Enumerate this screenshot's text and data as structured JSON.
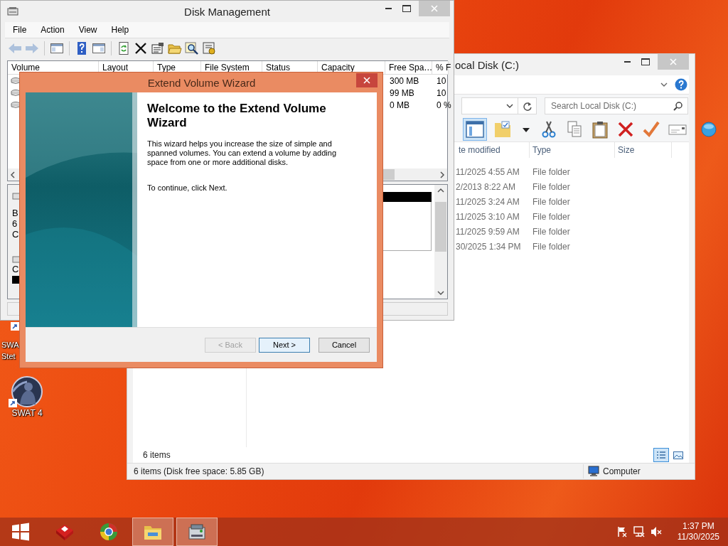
{
  "desktop_icons": [
    {
      "kind": "partial",
      "label_lines": [
        "SWA",
        "Stet"
      ]
    },
    {
      "kind": "game",
      "label_lines": [
        "SWAT 4"
      ]
    }
  ],
  "disk_management": {
    "title": "Disk Management",
    "menu": [
      "File",
      "Action",
      "View",
      "Help"
    ],
    "toolbar": [
      {
        "kind": "back",
        "disabled": true
      },
      {
        "kind": "forward",
        "disabled": true
      },
      {
        "kind": "console",
        "disabled": false
      },
      {
        "kind": "help",
        "disabled": false
      },
      {
        "kind": "action",
        "disabled": false
      },
      {
        "kind": "refresh",
        "disabled": false
      },
      {
        "kind": "delete",
        "disabled": false
      },
      {
        "kind": "properties",
        "disabled": false
      },
      {
        "kind": "open",
        "disabled": false
      },
      {
        "kind": "find",
        "disabled": false
      },
      {
        "kind": "settings",
        "disabled": false
      }
    ],
    "columns": [
      "Volume",
      "Layout",
      "Type",
      "File System",
      "Status",
      "Capacity",
      "Free Spa…",
      "% F"
    ],
    "rows": [
      {
        "free_space": "300 MB",
        "percent_free": "10"
      },
      {
        "free_space": "99 MB",
        "percent_free": "10"
      },
      {
        "free_space": "0 MB",
        "percent_free": "0 %"
      }
    ],
    "disk_info_lines": [
      "B",
      "6",
      "C"
    ],
    "cdrom_label": "C"
  },
  "explorer": {
    "title": "ocal Disk (C:)",
    "search_placeholder": "Search Local Disk (C:)",
    "preview_pane_active": true,
    "toolbar": [
      {
        "kind": "preview-pane"
      },
      {
        "kind": "folder-check"
      },
      {
        "kind": "dropdown"
      },
      {
        "kind": "cut"
      },
      {
        "kind": "copy"
      },
      {
        "kind": "paste"
      },
      {
        "kind": "delete"
      },
      {
        "kind": "check"
      },
      {
        "kind": "rename"
      },
      {
        "kind": "globe"
      }
    ],
    "columns": [
      "te modified",
      "Type",
      "Size"
    ],
    "rows": [
      {
        "date_modified": "11/2025 4:55 AM",
        "type": "File folder"
      },
      {
        "date_modified": "2/2013 8:22 AM",
        "type": "File folder"
      },
      {
        "date_modified": "11/2025 3:24 AM",
        "type": "File folder"
      },
      {
        "date_modified": "11/2025 3:10 AM",
        "type": "File folder"
      },
      {
        "date_modified": "11/2025 9:59 AM",
        "type": "File folder"
      },
      {
        "date_modified": "30/2025 1:34 PM",
        "type": "File folder"
      }
    ],
    "item_count": "6 items",
    "status_text": "6 items (Disk free space: 5.85 GB)",
    "status_location": "Computer",
    "view_buttons": [
      {
        "kind": "details",
        "selected": true
      },
      {
        "kind": "large-icons",
        "selected": false
      }
    ]
  },
  "wizard": {
    "title": "Extend Volume Wizard",
    "heading": "Welcome to the Extend Volume Wizard",
    "body": "This wizard helps you increase the size of simple and spanned volumes. You can extend a volume by adding space from one or more additional disks.",
    "continue_text": "To continue, click Next.",
    "buttons": [
      {
        "label": "< Back",
        "disabled": true,
        "default": false
      },
      {
        "label": "Next >",
        "disabled": false,
        "default": true
      },
      {
        "label": "Cancel",
        "disabled": false,
        "default": false
      }
    ]
  },
  "taskbar": {
    "apps": [
      {
        "kind": "start",
        "active": false
      },
      {
        "kind": "red-app",
        "active": false
      },
      {
        "kind": "browser",
        "active": false
      },
      {
        "kind": "file-explorer",
        "active": true
      },
      {
        "kind": "disk-tool",
        "active": true
      }
    ],
    "tray": [
      {
        "kind": "flag"
      },
      {
        "kind": "network"
      },
      {
        "kind": "volume-muted"
      }
    ],
    "time": "1:37 PM",
    "date": "11/30/2025"
  }
}
